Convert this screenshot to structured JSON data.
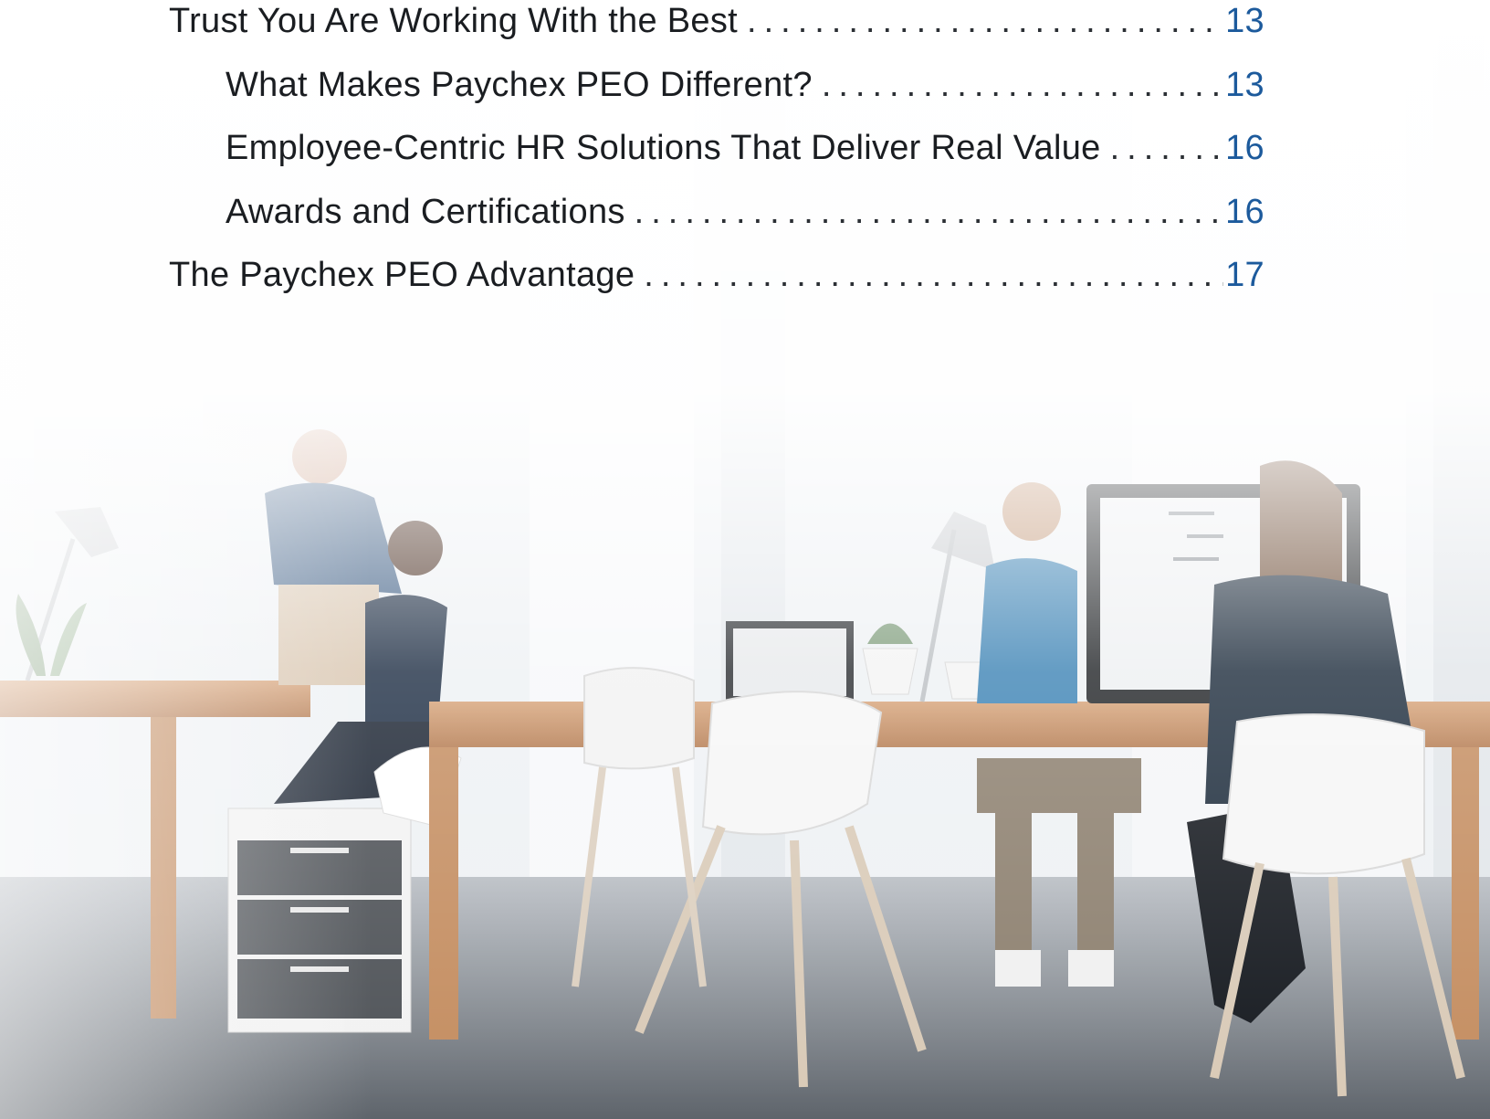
{
  "toc": {
    "entries": [
      {
        "title": "Trust You Are Working With the Best",
        "page": "13",
        "level": 1
      },
      {
        "title": "What Makes Paychex PEO Different?",
        "page": "13",
        "level": 2
      },
      {
        "title": "Employee-Centric HR Solutions That Deliver Real Value",
        "page": "16",
        "level": 2
      },
      {
        "title": "Awards and Certifications",
        "page": "16",
        "level": 2
      },
      {
        "title": "The Paychex PEO Advantage",
        "page": "17",
        "level": 1
      }
    ]
  },
  "colors": {
    "page_number": "#1c5a9c",
    "text": "#1a1d21"
  }
}
